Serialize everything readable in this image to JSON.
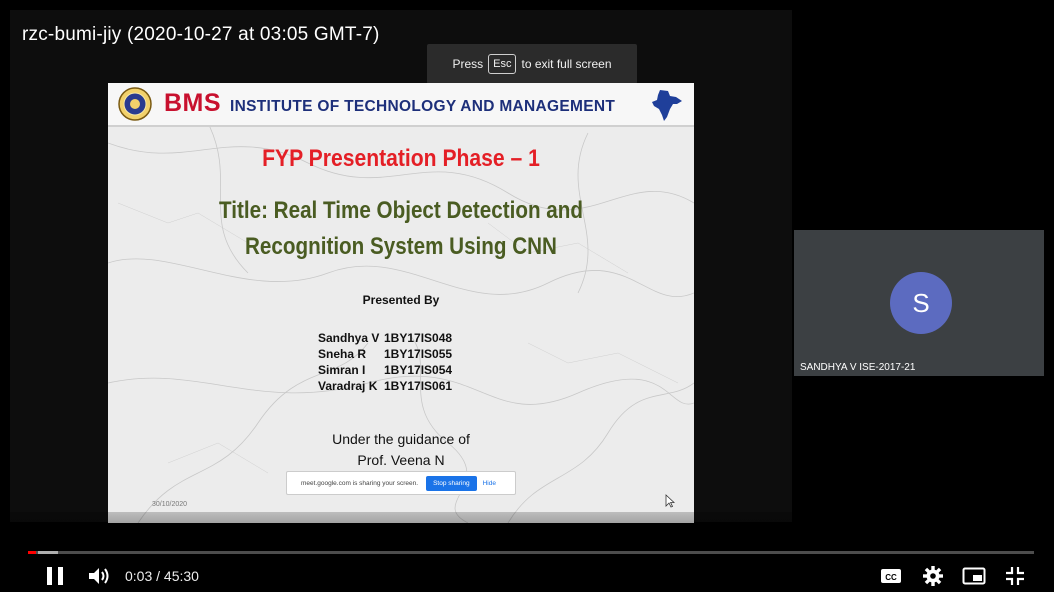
{
  "window": {
    "title": "rzc-bumi-jiy (2020-10-27 at 03:05 GMT-7)"
  },
  "fullscreen_hint": {
    "prefix": "Press",
    "key": "Esc",
    "suffix": "to exit full screen"
  },
  "slide": {
    "header": {
      "brand": "BMS",
      "institute": "INSTITUTE OF TECHNOLOGY AND MANAGEMENT"
    },
    "phase": "FYP Presentation Phase – 1",
    "title_line1": "Title: Real Time Object Detection and",
    "title_line2": "Recognition System Using CNN",
    "presented_by": "Presented By",
    "members": [
      {
        "name": "Sandhya V",
        "usn": "1BY17IS048"
      },
      {
        "name": "Sneha R",
        "usn": "1BY17IS055"
      },
      {
        "name": "Simran I",
        "usn": "1BY17IS054"
      },
      {
        "name": "Varadraj K",
        "usn": "1BY17IS061"
      }
    ],
    "guidance_line1": "Under the guidance of",
    "guidance_line2": "Prof. Veena N",
    "date": "30/10/2020",
    "share_bar": {
      "message": "meet.google.com is sharing your screen.",
      "stop": "Stop sharing",
      "hide": "Hide"
    }
  },
  "participant": {
    "initial": "S",
    "name": "SANDHYA V ISE-2017-21",
    "avatar_color": "#5c6bc0"
  },
  "player": {
    "time": "0:03 / 45:30",
    "progress_fraction": 0.0011,
    "accent": "#ff0000"
  },
  "icons": [
    "pause-icon",
    "volume-icon",
    "captions-icon",
    "settings-icon",
    "miniplayer-icon",
    "exit-fullscreen-icon"
  ]
}
